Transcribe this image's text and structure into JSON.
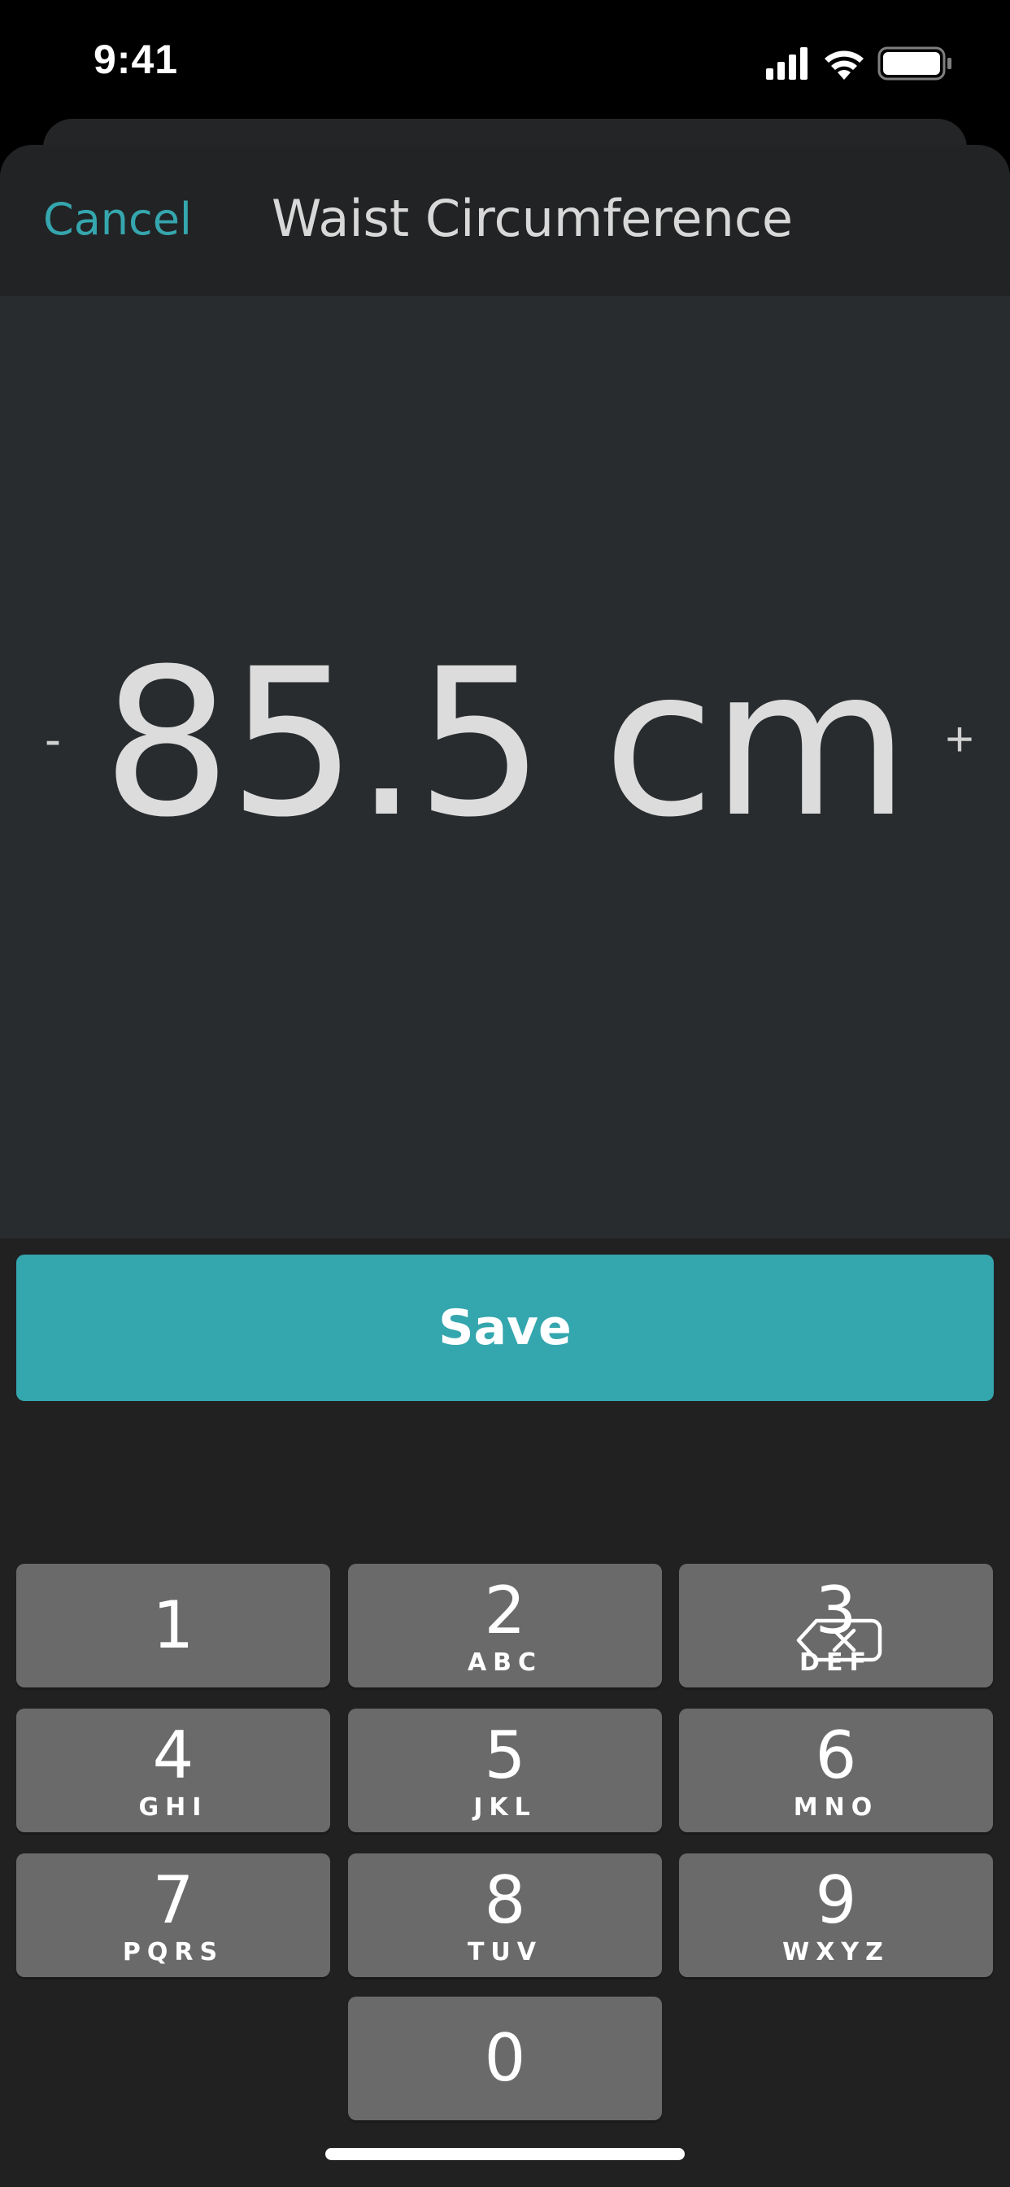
{
  "status_bar": {
    "time": "9:41",
    "icons": [
      "cellular-signal-icon",
      "wifi-icon",
      "battery-icon"
    ]
  },
  "header": {
    "cancel_label": "Cancel",
    "title": "Waist Circumference"
  },
  "measurement": {
    "decrement_label": "-",
    "increment_label": "+",
    "value_text": "85.5 cm"
  },
  "actions": {
    "save_label": "Save"
  },
  "keypad": {
    "keys": [
      {
        "digit": "1",
        "letters": ""
      },
      {
        "digit": "2",
        "letters": "ABC"
      },
      {
        "digit": "3",
        "letters": "DEF"
      },
      {
        "digit": "4",
        "letters": "GHI"
      },
      {
        "digit": "5",
        "letters": "JKL"
      },
      {
        "digit": "6",
        "letters": "MNO"
      },
      {
        "digit": "7",
        "letters": "PQRS"
      },
      {
        "digit": "8",
        "letters": "TUV"
      },
      {
        "digit": "9",
        "letters": "WXYZ"
      },
      {
        "digit": "0",
        "letters": ""
      }
    ],
    "delete_icon": "delete-backspace-icon"
  },
  "colors": {
    "accent": "#34a6ae",
    "background": "#222324",
    "value_panel": "#292c2e",
    "key": "#6a6a6a"
  }
}
